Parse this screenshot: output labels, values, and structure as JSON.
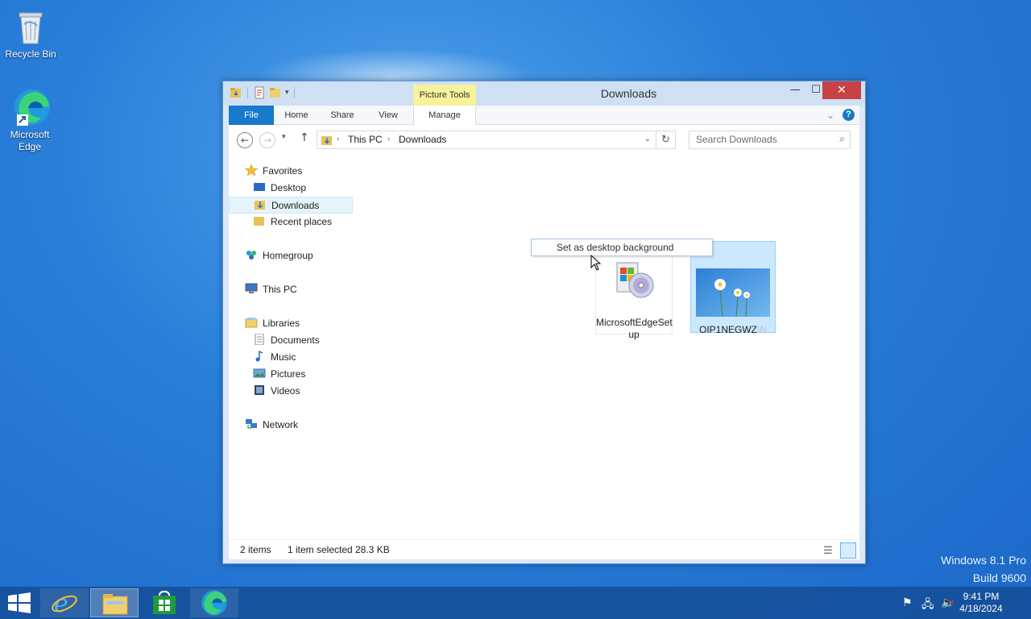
{
  "desktop": {
    "icons": [
      {
        "label": "Recycle Bin"
      },
      {
        "label": "Microsoft Edge"
      }
    ],
    "watermark_line1": "Windows 8.1 Pro",
    "watermark_line2": "Build 9600"
  },
  "window": {
    "title": "Downloads",
    "contextual_tab_group": "Picture Tools",
    "controls": {
      "minimize": "—",
      "maximize": "☐",
      "close": "✕"
    }
  },
  "ribbon": {
    "tabs": [
      "File",
      "Home",
      "Share",
      "View",
      "Manage"
    ]
  },
  "address": {
    "crumbs": [
      "This PC",
      "Downloads"
    ],
    "search_placeholder": "Search Downloads"
  },
  "nav": {
    "favorites": "Favorites",
    "desktop": "Desktop",
    "downloads": "Downloads",
    "recent": "Recent places",
    "homegroup": "Homegroup",
    "thispc": "This PC",
    "libraries": "Libraries",
    "documents": "Documents",
    "music": "Music",
    "pictures": "Pictures",
    "videos": "Videos",
    "network": "Network"
  },
  "files": [
    {
      "name_line1": "MicrosoftEdgeSet",
      "name_line2": "up"
    },
    {
      "name": "OIP1NEGWZ",
      "name_faded": "IN"
    }
  ],
  "context_menu": {
    "item": "Set as desktop background"
  },
  "status": {
    "count": "2 items",
    "selection": "1 item selected",
    "size": "28.3 KB"
  },
  "taskbar": {
    "time": "9:41 PM",
    "date": "4/18/2024"
  },
  "colors": {
    "accent": "#1979ca",
    "close": "#c74244",
    "picture_tools": "#f6f39b",
    "selection": "#cce8ff"
  }
}
